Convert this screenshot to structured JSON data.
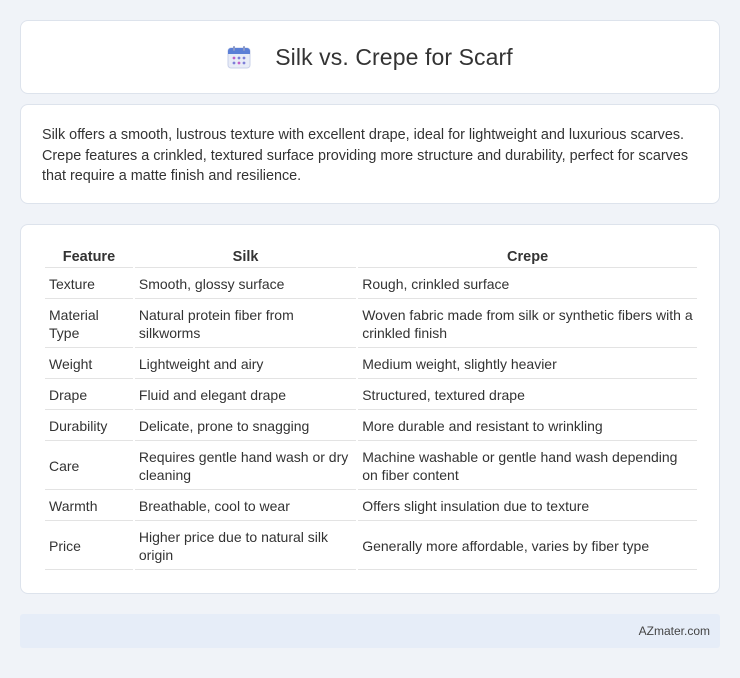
{
  "header": {
    "title": "Silk vs. Crepe for Scarf",
    "icon": "calendar-icon"
  },
  "intro": {
    "text": "Silk offers a smooth, lustrous texture with excellent drape, ideal for lightweight and luxurious scarves. Crepe features a crinkled, textured surface providing more structure and durability, perfect for scarves that require a matte finish and resilience."
  },
  "table": {
    "headers": [
      "Feature",
      "Silk",
      "Crepe"
    ],
    "rows": [
      [
        "Texture",
        "Smooth, glossy surface",
        "Rough, crinkled surface"
      ],
      [
        "Material Type",
        "Natural protein fiber from silkworms",
        "Woven fabric made from silk or synthetic fibers with a crinkled finish"
      ],
      [
        "Weight",
        "Lightweight and airy",
        "Medium weight, slightly heavier"
      ],
      [
        "Drape",
        "Fluid and elegant drape",
        "Structured, textured drape"
      ],
      [
        "Durability",
        "Delicate, prone to snagging",
        "More durable and resistant to wrinkling"
      ],
      [
        "Care",
        "Requires gentle hand wash or dry cleaning",
        "Machine washable or gentle hand wash depending on fiber content"
      ],
      [
        "Warmth",
        "Breathable, cool to wear",
        "Offers slight insulation due to texture"
      ],
      [
        "Price",
        "Higher price due to natural silk origin",
        "Generally more affordable, varies by fiber type"
      ]
    ]
  },
  "footer": {
    "text": "AZmater.com"
  }
}
